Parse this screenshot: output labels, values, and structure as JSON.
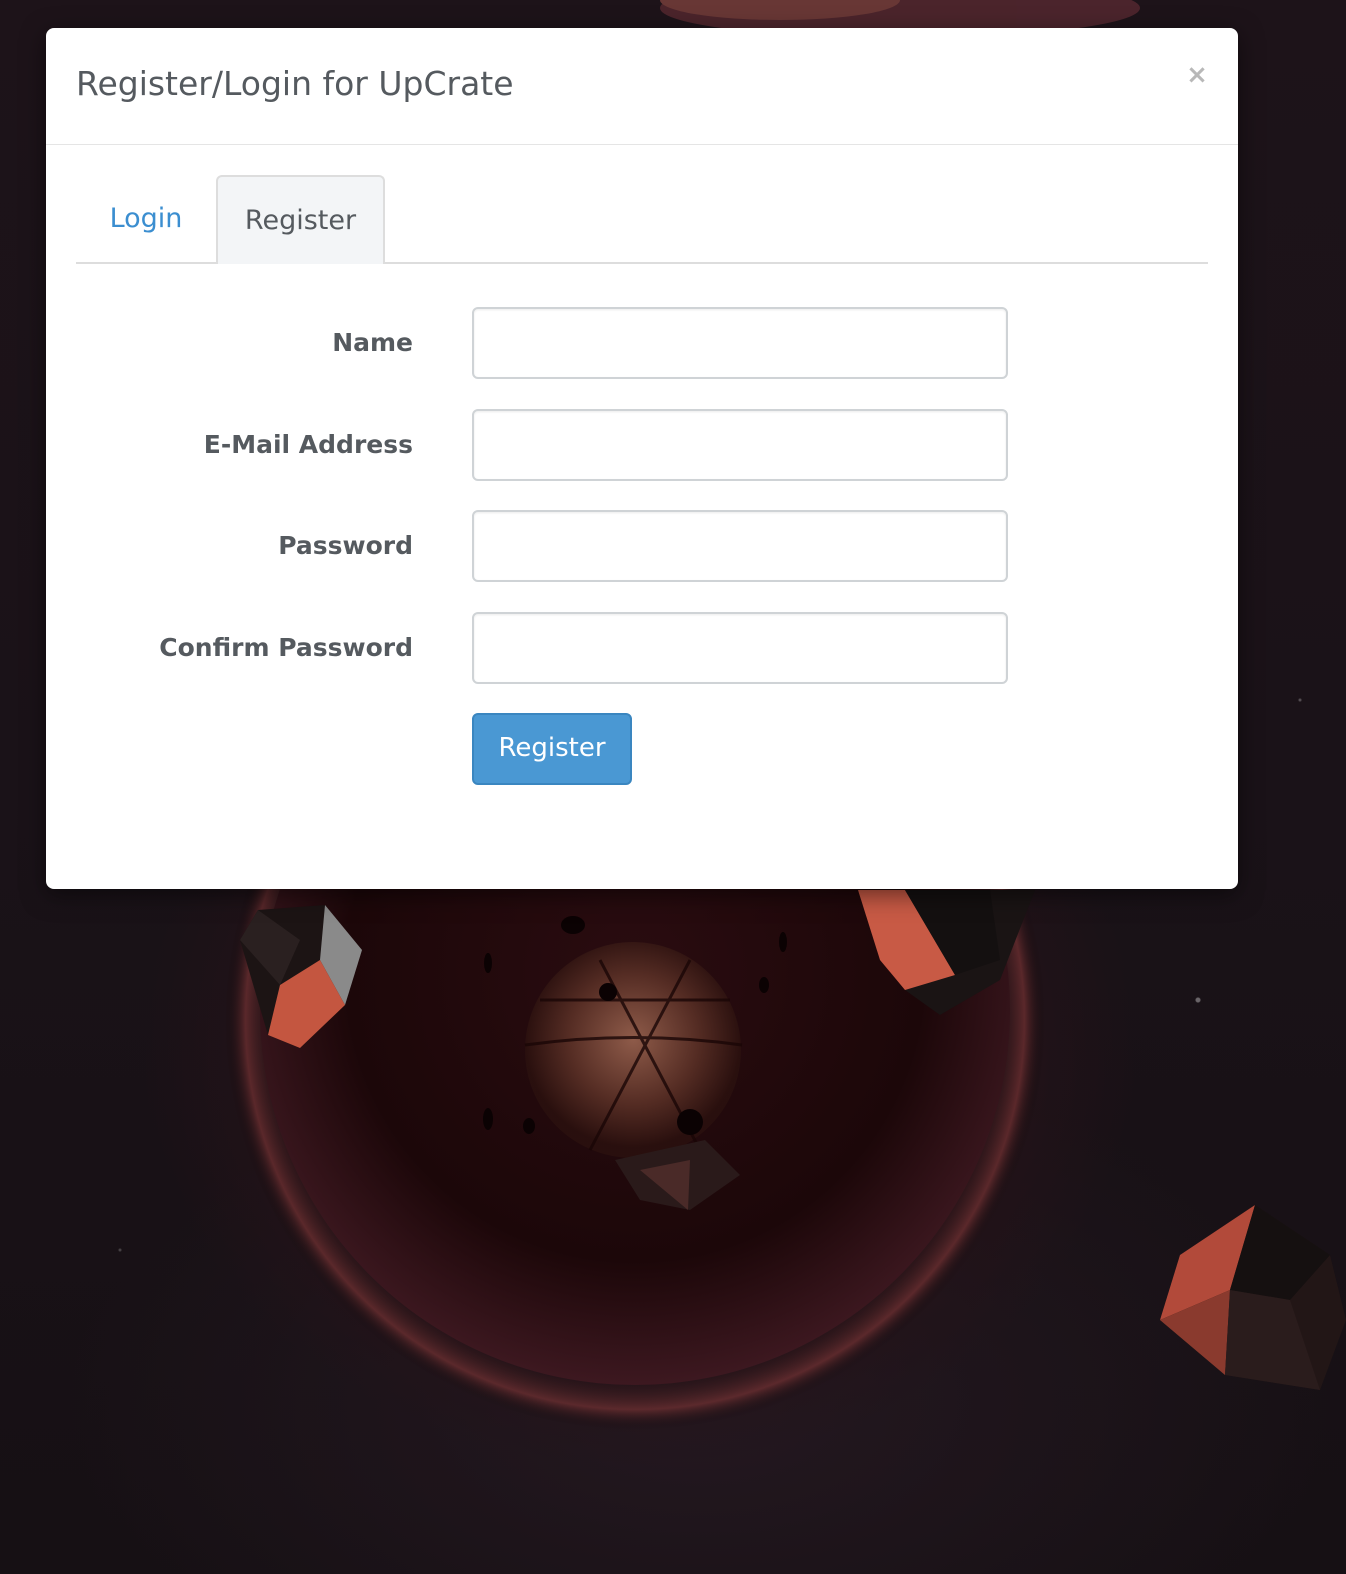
{
  "modal": {
    "title": "Register/Login for UpCrate",
    "close_label": "×"
  },
  "tabs": [
    {
      "label": "Login",
      "active": false
    },
    {
      "label": "Register",
      "active": true
    }
  ],
  "form": {
    "fields": [
      {
        "label": "Name",
        "value": "",
        "type": "text"
      },
      {
        "label": "E-Mail Address",
        "value": "",
        "type": "email"
      },
      {
        "label": "Password",
        "value": "",
        "type": "password"
      },
      {
        "label": "Confirm Password",
        "value": "",
        "type": "password"
      }
    ],
    "submit_label": "Register"
  },
  "colors": {
    "accent": "#4a98d3",
    "tab_link": "#3b8ed0",
    "text": "#555a5f"
  }
}
